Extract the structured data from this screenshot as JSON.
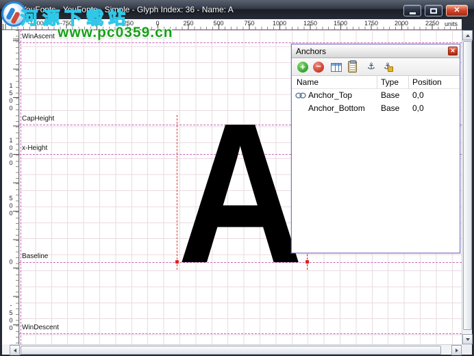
{
  "window": {
    "title": "YouFonts - YouFonts - Simple - Glyph Index: 36 - Name: A",
    "close_glyph": "✕"
  },
  "rulers": {
    "top_labels": [
      "-1000",
      "-750",
      "-500",
      "-250",
      "0",
      "250",
      "500",
      "750",
      "1000",
      "1250",
      "1500",
      "1750",
      "2000",
      "2250"
    ],
    "units_label": "units",
    "left_labels": [
      "1500",
      "1000",
      "500",
      "0",
      "-500"
    ]
  },
  "metrics": {
    "win_ascent": "WinAscent",
    "cap_height": "CapHeight",
    "x_height": "x-Height",
    "baseline": "Baseline",
    "win_descent": "WinDescent"
  },
  "glyph": {
    "character": "A"
  },
  "anchors_panel": {
    "title": "Anchors",
    "close_glyph": "✕",
    "toolbar": {
      "add_glyph": "+",
      "remove_glyph": "−",
      "anchor_glyph": "⚓"
    },
    "columns": {
      "name": "Name",
      "type": "Type",
      "position": "Position"
    },
    "rows": [
      {
        "name": "Anchor_Top",
        "type": "Base",
        "position": "0,0"
      },
      {
        "name": "Anchor_Bottom",
        "type": "Base",
        "position": "0,0"
      }
    ]
  },
  "watermark": {
    "line1": "河源下载站",
    "line2": "www.pc0359.cn"
  },
  "colors": {
    "metric_guide": "#c565b5",
    "sidebearing_guide": "#e03030",
    "grid_line": "#e9dae2",
    "close_red": "#ce3a1f",
    "watermark_green": "#17a017",
    "watermark_cyan": "#2fc8e8"
  }
}
